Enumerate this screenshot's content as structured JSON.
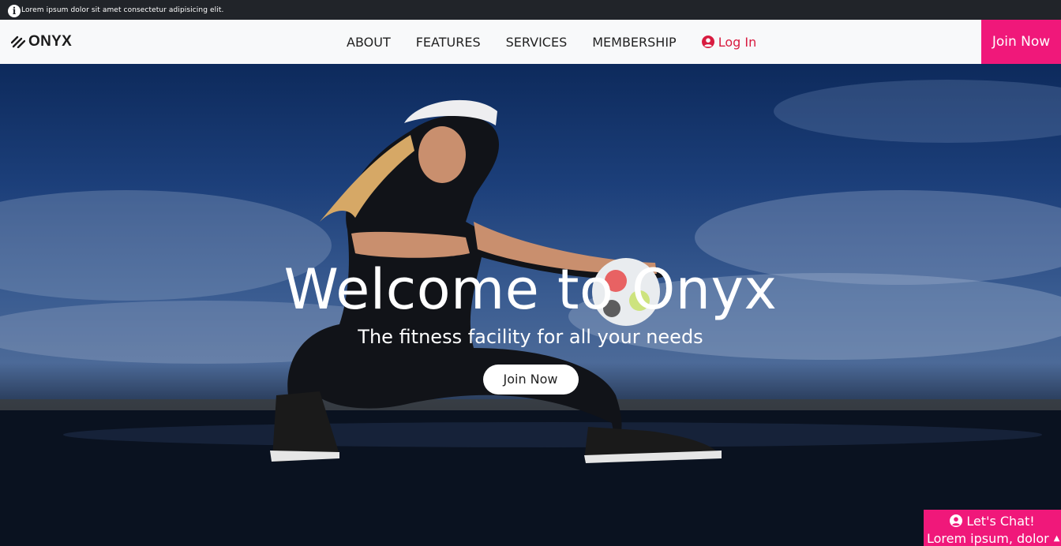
{
  "topbar": {
    "icon": "info-icon",
    "text": "Lorem ipsum dolor sit amet consectetur adipisicing elit."
  },
  "navbar": {
    "brand": "ONYX",
    "brand_icon": "stripes-logo-icon",
    "links": [
      {
        "label": "ABOUT"
      },
      {
        "label": "FEATURES"
      },
      {
        "label": "SERVICES"
      },
      {
        "label": "MEMBERSHIP"
      }
    ],
    "login_label": "Log In",
    "join_label": "Join Now",
    "colors": {
      "accent": "#f0187a",
      "login": "#d81b3f"
    }
  },
  "hero": {
    "title": "Welcome to Onyx",
    "subtitle": "The fitness facility for all your needs",
    "button_label": "Join Now"
  },
  "chat": {
    "title": "Let's Chat!",
    "subtitle": "Lorem ipsum, dolor",
    "icon": "user-circle-icon",
    "toggle_icon": "caret-up-icon"
  }
}
